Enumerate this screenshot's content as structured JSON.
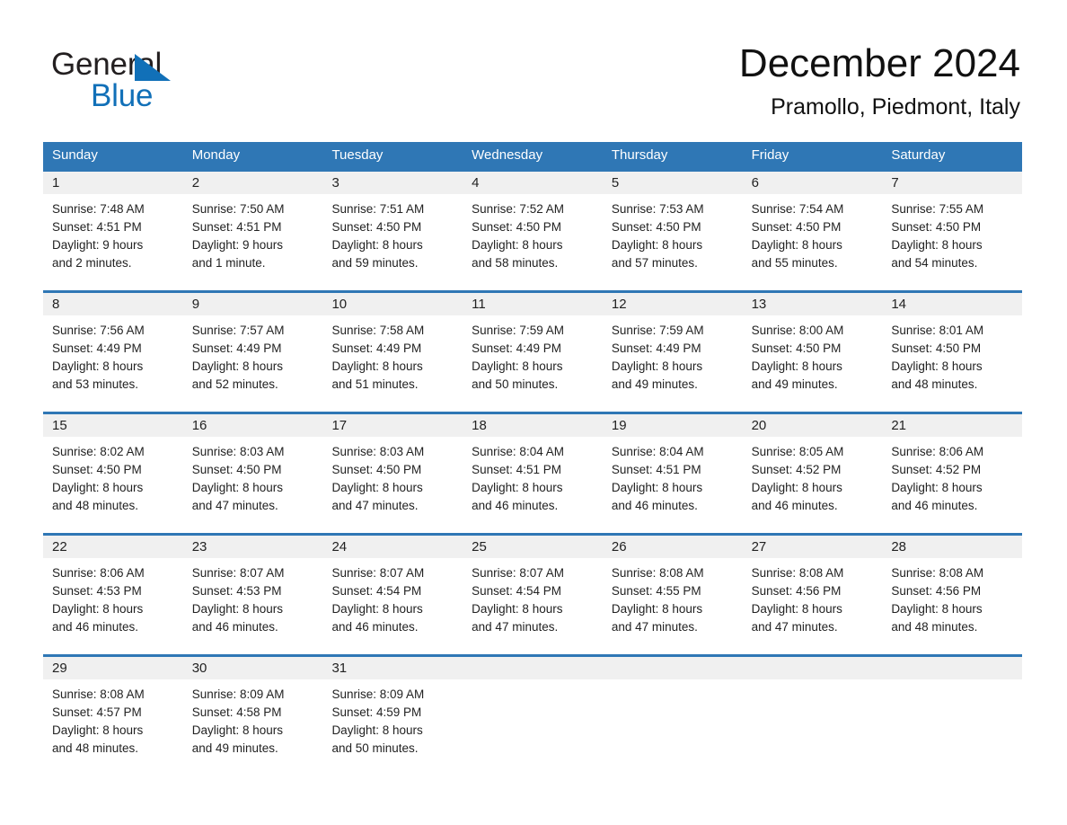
{
  "brand": {
    "name_part1": "General",
    "name_part2": "Blue",
    "triangle_color": "#1170b8"
  },
  "header": {
    "month_title": "December 2024",
    "location": "Pramollo, Piedmont, Italy"
  },
  "theme": {
    "header_blue": "#2f77b5",
    "day_band_gray": "#f0f0f0",
    "text_color": "#222222"
  },
  "weekdays": [
    "Sunday",
    "Monday",
    "Tuesday",
    "Wednesday",
    "Thursday",
    "Friday",
    "Saturday"
  ],
  "weeks": [
    {
      "days": [
        {
          "date": "1",
          "sunrise": "Sunrise: 7:48 AM",
          "sunset": "Sunset: 4:51 PM",
          "daylight_line1": "Daylight: 9 hours",
          "daylight_line2": "and 2 minutes."
        },
        {
          "date": "2",
          "sunrise": "Sunrise: 7:50 AM",
          "sunset": "Sunset: 4:51 PM",
          "daylight_line1": "Daylight: 9 hours",
          "daylight_line2": "and 1 minute."
        },
        {
          "date": "3",
          "sunrise": "Sunrise: 7:51 AM",
          "sunset": "Sunset: 4:50 PM",
          "daylight_line1": "Daylight: 8 hours",
          "daylight_line2": "and 59 minutes."
        },
        {
          "date": "4",
          "sunrise": "Sunrise: 7:52 AM",
          "sunset": "Sunset: 4:50 PM",
          "daylight_line1": "Daylight: 8 hours",
          "daylight_line2": "and 58 minutes."
        },
        {
          "date": "5",
          "sunrise": "Sunrise: 7:53 AM",
          "sunset": "Sunset: 4:50 PM",
          "daylight_line1": "Daylight: 8 hours",
          "daylight_line2": "and 57 minutes."
        },
        {
          "date": "6",
          "sunrise": "Sunrise: 7:54 AM",
          "sunset": "Sunset: 4:50 PM",
          "daylight_line1": "Daylight: 8 hours",
          "daylight_line2": "and 55 minutes."
        },
        {
          "date": "7",
          "sunrise": "Sunrise: 7:55 AM",
          "sunset": "Sunset: 4:50 PM",
          "daylight_line1": "Daylight: 8 hours",
          "daylight_line2": "and 54 minutes."
        }
      ]
    },
    {
      "days": [
        {
          "date": "8",
          "sunrise": "Sunrise: 7:56 AM",
          "sunset": "Sunset: 4:49 PM",
          "daylight_line1": "Daylight: 8 hours",
          "daylight_line2": "and 53 minutes."
        },
        {
          "date": "9",
          "sunrise": "Sunrise: 7:57 AM",
          "sunset": "Sunset: 4:49 PM",
          "daylight_line1": "Daylight: 8 hours",
          "daylight_line2": "and 52 minutes."
        },
        {
          "date": "10",
          "sunrise": "Sunrise: 7:58 AM",
          "sunset": "Sunset: 4:49 PM",
          "daylight_line1": "Daylight: 8 hours",
          "daylight_line2": "and 51 minutes."
        },
        {
          "date": "11",
          "sunrise": "Sunrise: 7:59 AM",
          "sunset": "Sunset: 4:49 PM",
          "daylight_line1": "Daylight: 8 hours",
          "daylight_line2": "and 50 minutes."
        },
        {
          "date": "12",
          "sunrise": "Sunrise: 7:59 AM",
          "sunset": "Sunset: 4:49 PM",
          "daylight_line1": "Daylight: 8 hours",
          "daylight_line2": "and 49 minutes."
        },
        {
          "date": "13",
          "sunrise": "Sunrise: 8:00 AM",
          "sunset": "Sunset: 4:50 PM",
          "daylight_line1": "Daylight: 8 hours",
          "daylight_line2": "and 49 minutes."
        },
        {
          "date": "14",
          "sunrise": "Sunrise: 8:01 AM",
          "sunset": "Sunset: 4:50 PM",
          "daylight_line1": "Daylight: 8 hours",
          "daylight_line2": "and 48 minutes."
        }
      ]
    },
    {
      "days": [
        {
          "date": "15",
          "sunrise": "Sunrise: 8:02 AM",
          "sunset": "Sunset: 4:50 PM",
          "daylight_line1": "Daylight: 8 hours",
          "daylight_line2": "and 48 minutes."
        },
        {
          "date": "16",
          "sunrise": "Sunrise: 8:03 AM",
          "sunset": "Sunset: 4:50 PM",
          "daylight_line1": "Daylight: 8 hours",
          "daylight_line2": "and 47 minutes."
        },
        {
          "date": "17",
          "sunrise": "Sunrise: 8:03 AM",
          "sunset": "Sunset: 4:50 PM",
          "daylight_line1": "Daylight: 8 hours",
          "daylight_line2": "and 47 minutes."
        },
        {
          "date": "18",
          "sunrise": "Sunrise: 8:04 AM",
          "sunset": "Sunset: 4:51 PM",
          "daylight_line1": "Daylight: 8 hours",
          "daylight_line2": "and 46 minutes."
        },
        {
          "date": "19",
          "sunrise": "Sunrise: 8:04 AM",
          "sunset": "Sunset: 4:51 PM",
          "daylight_line1": "Daylight: 8 hours",
          "daylight_line2": "and 46 minutes."
        },
        {
          "date": "20",
          "sunrise": "Sunrise: 8:05 AM",
          "sunset": "Sunset: 4:52 PM",
          "daylight_line1": "Daylight: 8 hours",
          "daylight_line2": "and 46 minutes."
        },
        {
          "date": "21",
          "sunrise": "Sunrise: 8:06 AM",
          "sunset": "Sunset: 4:52 PM",
          "daylight_line1": "Daylight: 8 hours",
          "daylight_line2": "and 46 minutes."
        }
      ]
    },
    {
      "days": [
        {
          "date": "22",
          "sunrise": "Sunrise: 8:06 AM",
          "sunset": "Sunset: 4:53 PM",
          "daylight_line1": "Daylight: 8 hours",
          "daylight_line2": "and 46 minutes."
        },
        {
          "date": "23",
          "sunrise": "Sunrise: 8:07 AM",
          "sunset": "Sunset: 4:53 PM",
          "daylight_line1": "Daylight: 8 hours",
          "daylight_line2": "and 46 minutes."
        },
        {
          "date": "24",
          "sunrise": "Sunrise: 8:07 AM",
          "sunset": "Sunset: 4:54 PM",
          "daylight_line1": "Daylight: 8 hours",
          "daylight_line2": "and 46 minutes."
        },
        {
          "date": "25",
          "sunrise": "Sunrise: 8:07 AM",
          "sunset": "Sunset: 4:54 PM",
          "daylight_line1": "Daylight: 8 hours",
          "daylight_line2": "and 47 minutes."
        },
        {
          "date": "26",
          "sunrise": "Sunrise: 8:08 AM",
          "sunset": "Sunset: 4:55 PM",
          "daylight_line1": "Daylight: 8 hours",
          "daylight_line2": "and 47 minutes."
        },
        {
          "date": "27",
          "sunrise": "Sunrise: 8:08 AM",
          "sunset": "Sunset: 4:56 PM",
          "daylight_line1": "Daylight: 8 hours",
          "daylight_line2": "and 47 minutes."
        },
        {
          "date": "28",
          "sunrise": "Sunrise: 8:08 AM",
          "sunset": "Sunset: 4:56 PM",
          "daylight_line1": "Daylight: 8 hours",
          "daylight_line2": "and 48 minutes."
        }
      ]
    },
    {
      "days": [
        {
          "date": "29",
          "sunrise": "Sunrise: 8:08 AM",
          "sunset": "Sunset: 4:57 PM",
          "daylight_line1": "Daylight: 8 hours",
          "daylight_line2": "and 48 minutes."
        },
        {
          "date": "30",
          "sunrise": "Sunrise: 8:09 AM",
          "sunset": "Sunset: 4:58 PM",
          "daylight_line1": "Daylight: 8 hours",
          "daylight_line2": "and 49 minutes."
        },
        {
          "date": "31",
          "sunrise": "Sunrise: 8:09 AM",
          "sunset": "Sunset: 4:59 PM",
          "daylight_line1": "Daylight: 8 hours",
          "daylight_line2": "and 50 minutes."
        },
        {
          "date": "",
          "sunrise": "",
          "sunset": "",
          "daylight_line1": "",
          "daylight_line2": ""
        },
        {
          "date": "",
          "sunrise": "",
          "sunset": "",
          "daylight_line1": "",
          "daylight_line2": ""
        },
        {
          "date": "",
          "sunrise": "",
          "sunset": "",
          "daylight_line1": "",
          "daylight_line2": ""
        },
        {
          "date": "",
          "sunrise": "",
          "sunset": "",
          "daylight_line1": "",
          "daylight_line2": ""
        }
      ]
    }
  ]
}
